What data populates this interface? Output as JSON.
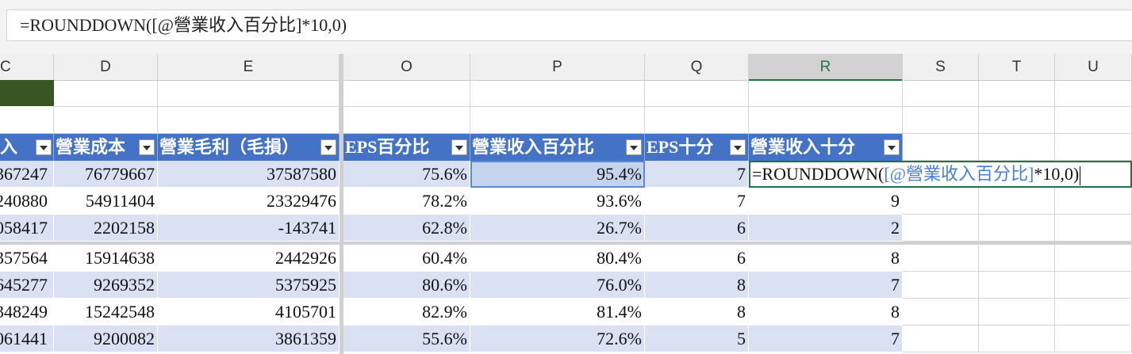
{
  "formula_bar": {
    "text": "=ROUNDDOWN([@營業收入百分比]*10,0)"
  },
  "columns": [
    "C",
    "D",
    "E",
    "O",
    "P",
    "Q",
    "R",
    "S",
    "T",
    "U"
  ],
  "table_headers": {
    "c": "收入",
    "d": "營業成本",
    "e": "營業毛利（毛損）",
    "o": "EPS百分比",
    "p": "營業收入百分比",
    "q": "EPS十分",
    "r": "營業收入十分"
  },
  "rows": [
    {
      "c": "367247",
      "d": "76779667",
      "e": "37587580",
      "o": "75.6%",
      "p": "95.4%",
      "q": "7",
      "r": ""
    },
    {
      "c": "240880",
      "d": "54911404",
      "e": "23329476",
      "o": "78.2%",
      "p": "93.6%",
      "q": "7",
      "r": "9"
    },
    {
      "c": "058417",
      "d": "2202158",
      "e": "-143741",
      "o": "62.8%",
      "p": "26.7%",
      "q": "6",
      "r": "2"
    },
    {
      "c": "357564",
      "d": "15914638",
      "e": "2442926",
      "o": "60.4%",
      "p": "80.4%",
      "q": "6",
      "r": "8"
    },
    {
      "c": "645277",
      "d": "9269352",
      "e": "5375925",
      "o": "80.6%",
      "p": "76.0%",
      "q": "8",
      "r": "7"
    },
    {
      "c": "348249",
      "d": "15242548",
      "e": "4105701",
      "o": "82.9%",
      "p": "81.4%",
      "q": "8",
      "r": "8"
    },
    {
      "c": "061441",
      "d": "9200082",
      "e": "3861359",
      "o": "55.6%",
      "p": "72.6%",
      "q": "5",
      "r": "7"
    }
  ],
  "edit_cell": {
    "prefix": "=ROUNDDOWN(",
    "ref": "[@營業收入百分比]",
    "suffix": "*10,0)"
  },
  "colors": {
    "header_blue": "#4472c4",
    "band_blue": "#d9e1f2",
    "excel_green": "#217346",
    "dark_green_fill": "#375623"
  }
}
